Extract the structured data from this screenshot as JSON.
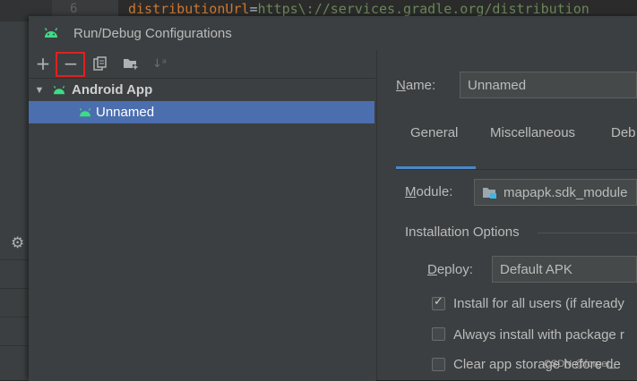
{
  "editor": {
    "line_number": "6",
    "code_key": "distributionUrl",
    "code_eq": "=",
    "code_value": "https\\://services.gradle.org/distribution"
  },
  "dialog": {
    "title": "Run/Debug Configurations",
    "toolbar": {
      "add_icon": "plus-icon",
      "remove_icon": "minus-icon",
      "copy_icon": "copy-icon",
      "folder_icon": "new-folder-icon",
      "sort_icon": "sort-alpha-icon"
    },
    "tree": {
      "group_label": "Android App",
      "item_label": "Unnamed"
    },
    "form": {
      "name_label_prefix": "N",
      "name_label_rest": "ame:",
      "name_value": "Unnamed",
      "tabs": [
        "General",
        "Miscellaneous",
        "Deb"
      ],
      "module_label_prefix": "M",
      "module_label_rest": "odule:",
      "module_value": "mapapk.sdk_module",
      "installation_section": "Installation Options",
      "deploy_label_prefix": "D",
      "deploy_label_rest": "eploy:",
      "deploy_value": "Default APK",
      "checkboxes": [
        {
          "label": "Install for all users (if already",
          "checked": true
        },
        {
          "label": "Always install with package r",
          "checked": false
        },
        {
          "label": "Clear app storage before de",
          "checked": false
        }
      ]
    }
  },
  "watermark": "CSDN @forget_",
  "colors": {
    "selection": "#4b6eaf",
    "android_green": "#3ddc84",
    "highlight_box": "#e02020",
    "tab_accent": "#4a88c7"
  }
}
